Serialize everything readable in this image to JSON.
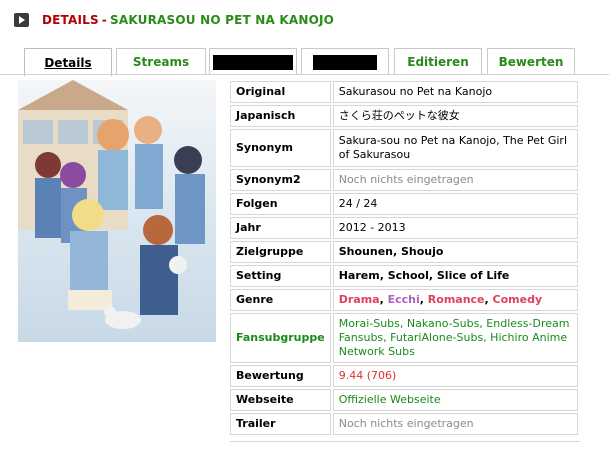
{
  "header": {
    "icon": "play-icon",
    "label": "DETAILS",
    "separator": "-",
    "name": "SAKURASOU NO PET NA KANOJO"
  },
  "tabs": [
    {
      "label": "Details",
      "active": true
    },
    {
      "label": "Streams"
    },
    {
      "label": "",
      "redacted": true
    },
    {
      "label": "",
      "redacted": true
    },
    {
      "label": "Editieren"
    },
    {
      "label": "Bewerten"
    }
  ],
  "cover": {
    "name": "anime-cover-image"
  },
  "details": {
    "original": {
      "label": "Original",
      "value": "Sakurasou no Pet na Kanojo"
    },
    "japanisch": {
      "label": "Japanisch",
      "value": "さくら荘のペットな彼女"
    },
    "synonym": {
      "label": "Synonym",
      "value": "Sakura-sou no Pet na Kanojo, The Pet Girl of Sakurasou"
    },
    "synonym2": {
      "label": "Synonym2",
      "value": "Noch nichts eingetragen"
    },
    "folgen": {
      "label": "Folgen",
      "value": "24 / 24"
    },
    "jahr": {
      "label": "Jahr",
      "value": "2012 - 2013"
    },
    "zielgruppe": {
      "label": "Zielgruppe",
      "value": "Shounen, Shoujo"
    },
    "setting": {
      "label": "Setting",
      "value": "Harem, School, Slice of Life"
    },
    "genre": {
      "label": "Genre",
      "items": [
        {
          "text": "Drama",
          "color": "#e0405a"
        },
        {
          "text": "Ecchi",
          "color": "#b060c0"
        },
        {
          "text": "Romance",
          "color": "#e0405a"
        },
        {
          "text": "Comedy",
          "color": "#e0405a"
        }
      ],
      "sep": ", "
    },
    "fansub": {
      "label": "Fansubgruppe",
      "value": "Morai-Subs, Nakano-Subs, Endless-Dream Fansubs, FutariAlone-Subs, Hichiro Anime Network Subs"
    },
    "bewertung": {
      "label": "Bewertung",
      "value": "9.44 (706)"
    },
    "webseite": {
      "label": "Webseite",
      "value": "Offizielle Webseite"
    },
    "trailer": {
      "label": "Trailer",
      "value": "Noch nichts eingetragen"
    }
  },
  "colors": {
    "title_red": "#b30000",
    "green": "#2a8a1a",
    "rating_red": "#e03030"
  }
}
